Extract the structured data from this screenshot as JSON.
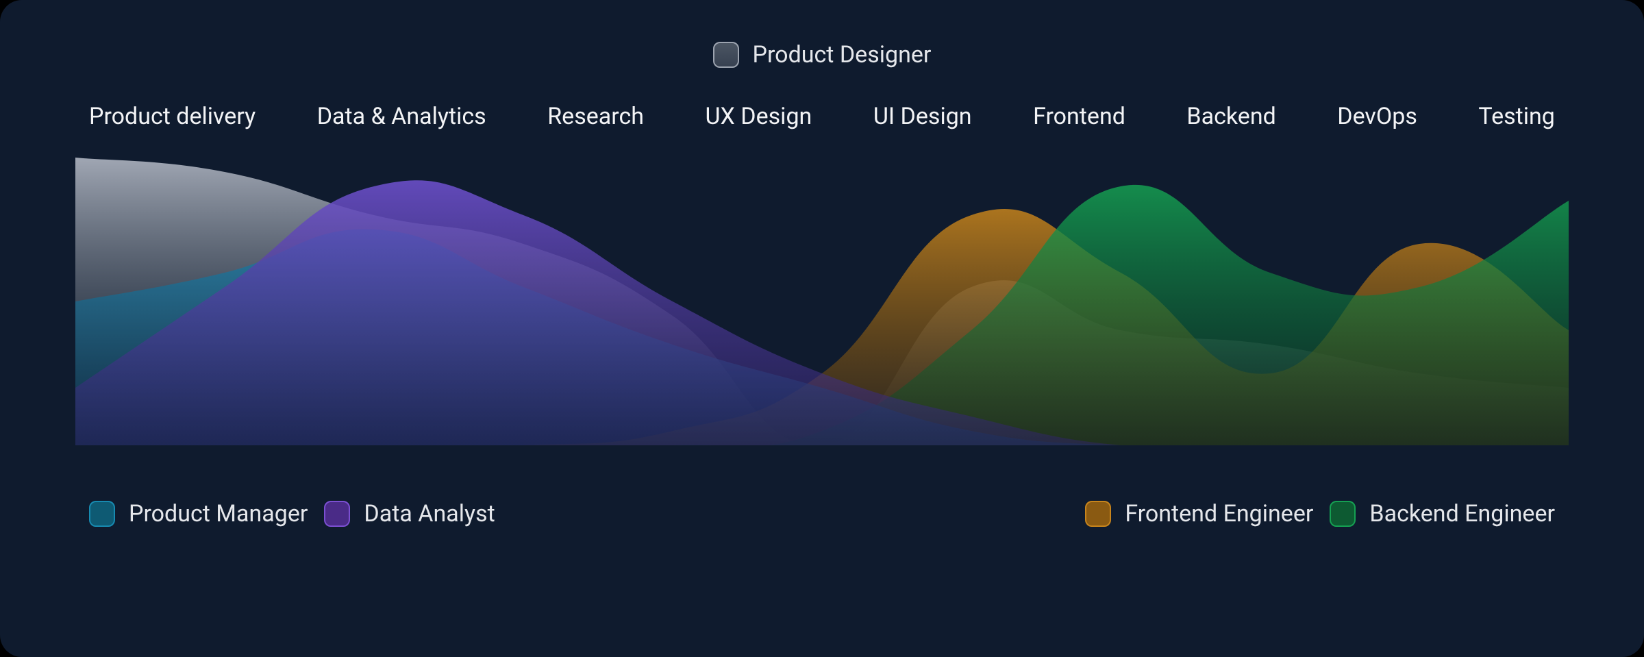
{
  "top_role": {
    "label": "Product Designer"
  },
  "categories": [
    "Product delivery",
    "Data & Analytics",
    "Research",
    "UX Design",
    "UI Design",
    "Frontend",
    "Backend",
    "DevOps",
    "Testing"
  ],
  "legend": {
    "pm": "Product Manager",
    "da": "Data Analyst",
    "fe": "Frontend Engineer",
    "be": "Backend Engineer"
  },
  "colors": {
    "bg": "#0f1b2e",
    "designer_top": "#9ca3af",
    "designer_mid": "#4b5563",
    "pm": "#1e6a8a",
    "da": "#5a3fa8",
    "fe": "#b07818",
    "be": "#0f7a3e"
  },
  "chart_data": {
    "type": "area",
    "title": "",
    "xlabel": "",
    "ylabel": "",
    "ylim": [
      0,
      100
    ],
    "categories": [
      "Product delivery",
      "Data & Analytics",
      "Research",
      "UX Design",
      "UI Design",
      "Frontend",
      "Backend",
      "DevOps",
      "Testing"
    ],
    "series": [
      {
        "name": "Product Designer",
        "values": [
          100,
          95,
          80,
          70,
          45,
          0,
          55,
          40,
          35,
          25,
          20
        ]
      },
      {
        "name": "Product Manager",
        "values": [
          50,
          60,
          75,
          55,
          35,
          20,
          5,
          0,
          0,
          0,
          0
        ]
      },
      {
        "name": "Data Analyst",
        "values": [
          20,
          55,
          90,
          80,
          50,
          25,
          10,
          0,
          0,
          0,
          0
        ]
      },
      {
        "name": "Frontend Engineer",
        "values": [
          0,
          0,
          0,
          0,
          5,
          25,
          80,
          60,
          25,
          70,
          40
        ]
      },
      {
        "name": "Backend Engineer",
        "values": [
          0,
          0,
          0,
          0,
          0,
          5,
          40,
          90,
          60,
          55,
          85
        ]
      }
    ]
  }
}
